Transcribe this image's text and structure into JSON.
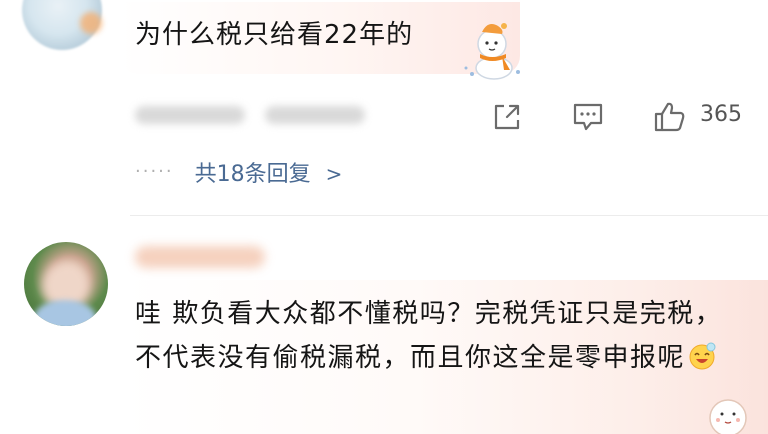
{
  "comment1": {
    "text": "为什么税只给看22年的",
    "likes": "365",
    "replies_label": "共18条回复",
    "replies_dots": "·····",
    "replies_chevron": ">"
  },
  "comment2": {
    "text": "哇 欺负看大众都不懂税吗？完税凭证只是完税，不代表没有偷税漏税，而且你这全是零申报呢"
  },
  "icons": [
    "share-icon",
    "comment-icon",
    "like-icon",
    "snowman-sticker-icon",
    "smile-emoji-icon"
  ],
  "colors": {
    "link": "#4a6a93",
    "count": "#555555",
    "bubble_tint": "#fde8e4"
  }
}
